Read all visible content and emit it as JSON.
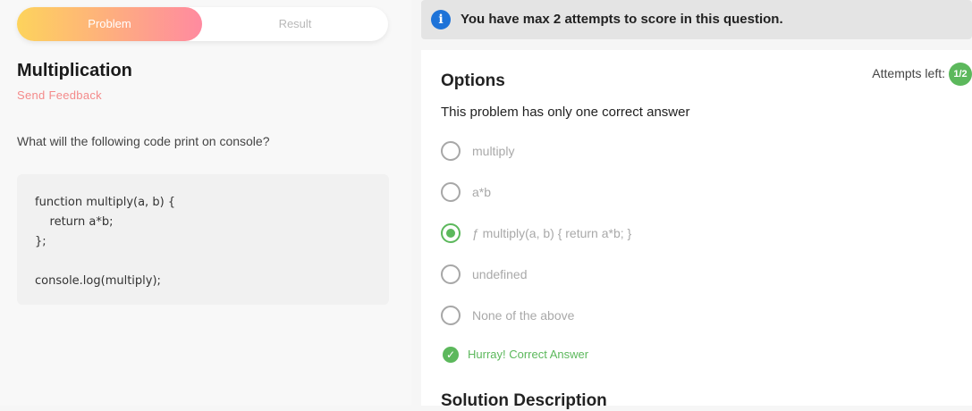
{
  "tabs": {
    "problem": "Problem",
    "result": "Result"
  },
  "problem": {
    "title": "Multiplication",
    "feedback": "Send Feedback",
    "question": "What will the following code print on console?",
    "code": [
      "function multiply(a, b) {",
      "    return a*b;",
      "};",
      "",
      "console.log(multiply);"
    ]
  },
  "banner": {
    "icon": "info-icon",
    "text": "You have max 2 attempts to score in this question."
  },
  "options": {
    "heading": "Options",
    "attempts_label": "Attempts left:",
    "attempts_value": "1/2",
    "subtitle": "This problem has only one correct answer",
    "items": [
      {
        "label": "multiply",
        "selected": false
      },
      {
        "label": "a*b",
        "selected": false
      },
      {
        "label": "ƒ multiply(a, b) { return a*b; }",
        "selected": true
      },
      {
        "label": "undefined",
        "selected": false
      },
      {
        "label": "None of the above",
        "selected": false
      }
    ],
    "result_text": "Hurray! Correct Answer"
  },
  "solution": {
    "heading": "Solution Description"
  },
  "colors": {
    "accent_green": "#5cb85c",
    "info_blue": "#1e73d8",
    "feedback_pink": "#f48a8a"
  }
}
